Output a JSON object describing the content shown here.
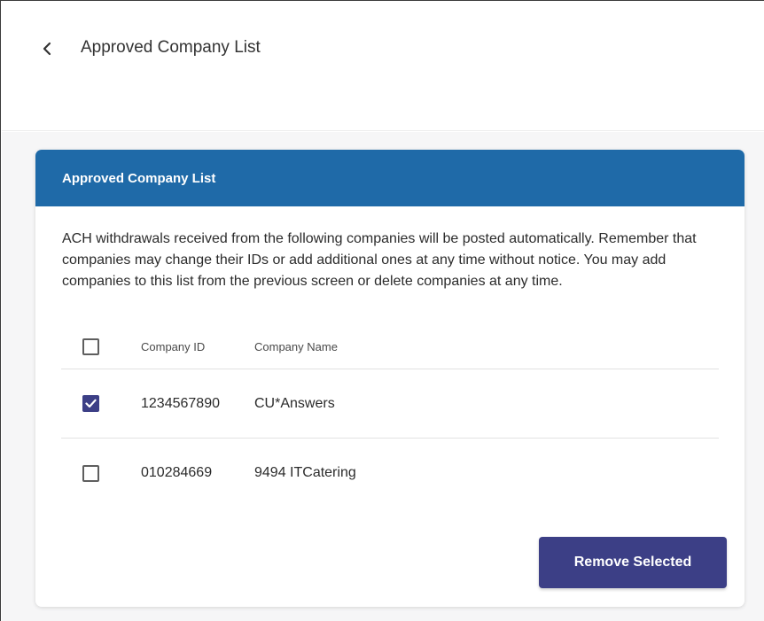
{
  "header": {
    "back_icon": "chevron-left-icon",
    "title": "Approved Company List"
  },
  "card": {
    "title": "Approved Company List",
    "description": "ACH withdrawals received from the following companies will be posted automatically. Remember that companies may change their IDs or add additional ones at any time without notice. You may add companies to this list from the previous screen or delete companies at any time.",
    "table": {
      "columns": [
        "Company ID",
        "Company Name"
      ],
      "select_all_checked": false,
      "rows": [
        {
          "company_id": "1234567890",
          "company_name": "CU*Answers",
          "checked": true
        },
        {
          "company_id": "010284669",
          "company_name": "9494 ITCatering",
          "checked": false
        }
      ]
    },
    "remove_button_label": "Remove Selected"
  },
  "colors": {
    "header_blue": "#1f6aa8",
    "primary_indigo": "#3c3f86",
    "background": "#f6f6f7"
  }
}
